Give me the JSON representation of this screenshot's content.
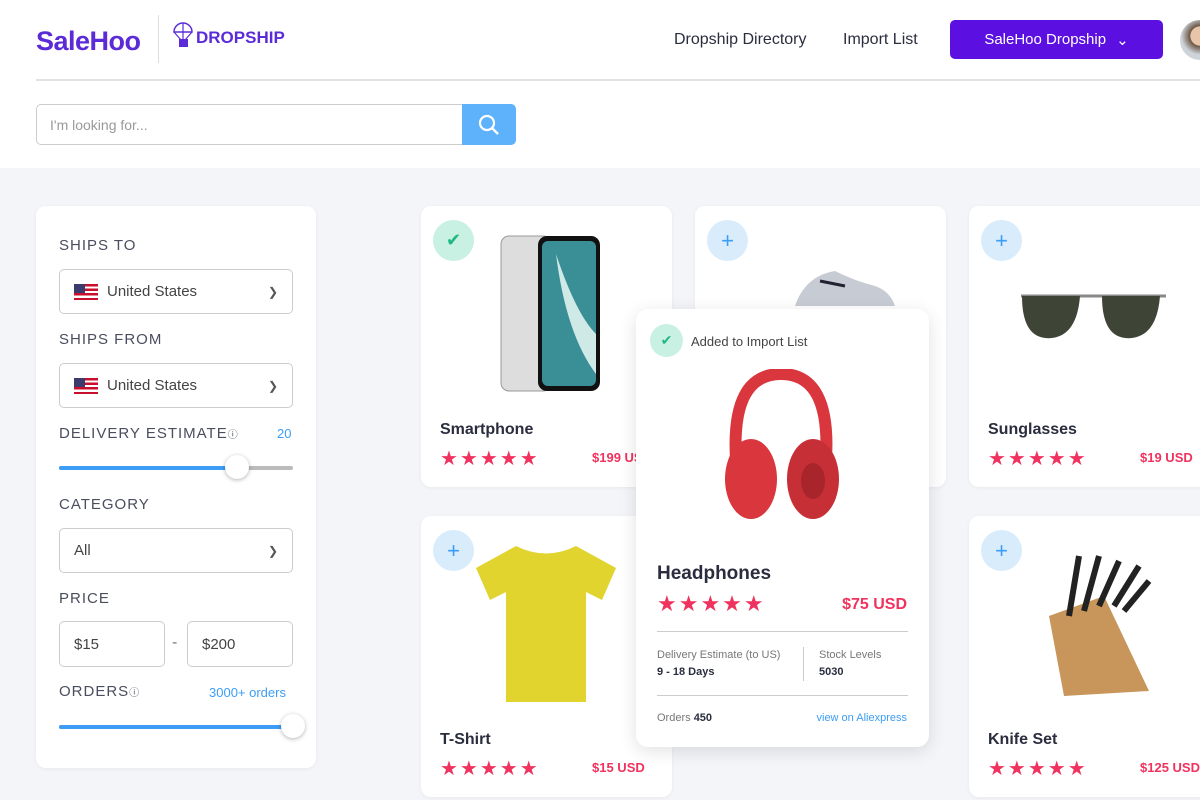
{
  "header": {
    "brand": "SaleHoo",
    "sub_brand": "DROPSHIP",
    "nav": [
      "Dropship Directory",
      "Import List"
    ],
    "account_button": "SaleHoo Dropship",
    "accent": "#5b0fe0"
  },
  "search": {
    "placeholder": "I'm looking for..."
  },
  "filters": {
    "ships_to_label": "SHIPS TO",
    "ships_to": "United States",
    "ships_from_label": "SHIPS FROM",
    "ships_from": "United States",
    "delivery_label": "DELIVERY ESTIMATE",
    "delivery_value": "20",
    "delivery_fraction": 0.76,
    "category_label": "CATEGORY",
    "category": "All",
    "price_label": "PRICE",
    "price_min": "$15",
    "price_sep": "-",
    "price_max": "$200",
    "orders_label": "ORDERS",
    "orders_value": "3000+ orders",
    "orders_fraction": 1.0
  },
  "products": [
    {
      "name": "Smartphone",
      "price": "$199 USD",
      "rating": 5,
      "added": true
    },
    {
      "name": "Sneakers",
      "price": "",
      "rating": 5,
      "added": false
    },
    {
      "name": "Sunglasses",
      "price": "$19 USD",
      "rating": 5,
      "added": false
    },
    {
      "name": "T-Shirt",
      "price": "$15 USD",
      "rating": 5,
      "added": false
    },
    {
      "name": "Knife Set",
      "price": "$125 USD",
      "rating": 5,
      "added": false
    }
  ],
  "popup": {
    "status": "Added to Import List",
    "name": "Headphones",
    "price": "$75 USD",
    "rating": 5,
    "delivery_label": "Delivery Estimate (to US)",
    "delivery_value": "9 - 18 Days",
    "stock_label": "Stock Levels",
    "stock_value": "5030",
    "orders_label": "Orders",
    "orders_value": "450",
    "link": "view on Aliexpress"
  },
  "stars": "★★★★★",
  "colors": {
    "price": "#f0325e",
    "link": "#3d9df5"
  }
}
